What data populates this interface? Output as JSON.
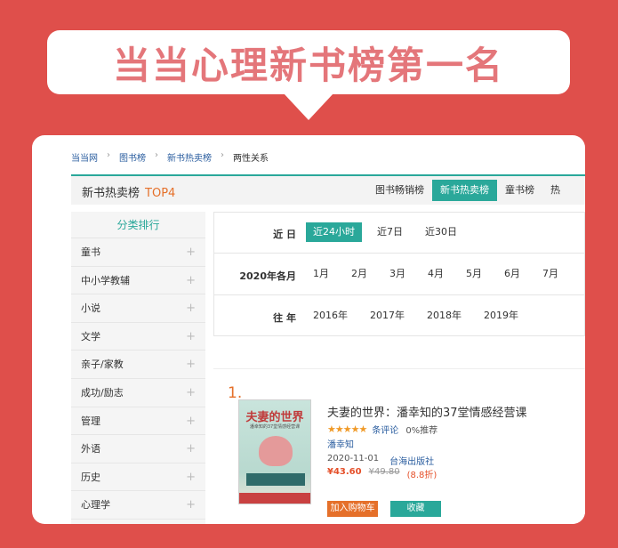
{
  "banner": {
    "title": "当当心理新书榜第一名"
  },
  "breadcrumb": [
    {
      "label": "当当网",
      "link": true
    },
    {
      "label": "图书榜",
      "link": true
    },
    {
      "label": "新书热卖榜",
      "link": true
    },
    {
      "label": "两性关系",
      "link": false
    }
  ],
  "titlebar": {
    "title": "新书热卖榜",
    "top": "TOP4",
    "tabs": [
      "图书畅销榜",
      "新书热卖榜",
      "童书榜",
      "热"
    ]
  },
  "sidebar": {
    "heading": "分类排行",
    "items": [
      "童书",
      "中小学教辅",
      "小说",
      "文学",
      "亲子/家教",
      "成功/励志",
      "管理",
      "外语",
      "历史",
      "心理学"
    ]
  },
  "filter": {
    "rows": [
      {
        "label": "近 日",
        "options": [
          "近24小时",
          "近7日",
          "近30日"
        ]
      },
      {
        "label": "2020年各月",
        "options": [
          "1月",
          "2月",
          "3月",
          "4月",
          "5月",
          "6月",
          "7月"
        ]
      },
      {
        "label": "往 年",
        "options": [
          "2016年",
          "2017年",
          "2018年",
          "2019年"
        ]
      }
    ]
  },
  "book": {
    "rank": "1.",
    "cover_title": "夫妻的世界",
    "cover_subtitle": "潘幸知的37堂情感经营课",
    "title": "夫妻的世界：潘幸知的37堂情感经营课",
    "stars": "★★★★★",
    "reviews": "条评论",
    "recommend": "0%推荐",
    "author": "潘幸知",
    "date": "2020-11-01",
    "publisher": "台海出版社",
    "price": "¥43.60",
    "original_price": "¥49.80",
    "discount": "(8.8折)",
    "cart_label": "加入购物车",
    "fav_label": "收藏"
  },
  "colors": {
    "accent": "#2aa89a",
    "orange": "#e5702a",
    "background": "#df4f4b",
    "banner_text": "#e4767a"
  }
}
